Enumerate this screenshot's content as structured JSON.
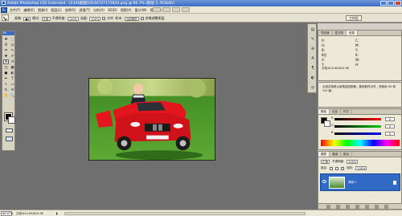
{
  "window": {
    "title": "Adobe Photoshop CS5 Extended - [2345截图20230727172834.png @ 66.7% (图层 1, RGB/8)]",
    "app_logo": "Ps",
    "minimize_icon": "minimize-icon",
    "maximize_icon": "maximize-icon",
    "close_icon": "close-icon"
  },
  "menu": {
    "items": [
      "文件(F)",
      "编辑(E)",
      "图像(I)",
      "图层(L)",
      "选择(S)",
      "滤镜(T)",
      "分析(A)",
      "3D(D)",
      "视图(V)",
      "窗口(W)",
      "帮助(H)"
    ]
  },
  "options": {
    "brush_label": "画笔:",
    "mode_label": "模式:",
    "mode_value": "正常",
    "opacity_label": "不透明度:",
    "opacity_value": "100%",
    "flow_label": "流量:",
    "flow_value": "100%",
    "align_label": "对齐",
    "sample_label": "样本:",
    "sample_value": "当前图层",
    "ignore_label": "忽略调整图层",
    "workspace": "工作区"
  },
  "toolbox": {
    "header": "Ps",
    "tools": [
      "move-tool",
      "marquee-tool",
      "lasso-tool",
      "quick-select-tool",
      "crop-tool",
      "eyedropper-tool",
      "healing-tool",
      "brush-tool",
      "clone-stamp-tool",
      "history-brush-tool",
      "eraser-tool",
      "gradient-tool",
      "blur-tool",
      "dodge-tool",
      "pen-tool",
      "type-tool",
      "path-select-tool",
      "shape-tool",
      "3d-rotate-tool",
      "3d-orbit-tool",
      "hand-tool",
      "zoom-tool"
    ],
    "glyphs": [
      "✥",
      "⬚",
      "ʘ",
      "◎",
      "⌗",
      "✎",
      "✚",
      "✐",
      "⊕",
      "↺",
      "◫",
      "▦",
      "●",
      "◐",
      "✒",
      "T",
      "↖",
      "▭",
      "↻",
      "⟲",
      "✋",
      "🔍"
    ],
    "selected_index": 8,
    "foreground_color": "#000000",
    "background_color": "#ffffff"
  },
  "status": {
    "zoom": "66.67%",
    "doc_info": "文档:614.9K/614.9K"
  },
  "info_panel": {
    "tabs": [
      "导航器",
      "直方图",
      "信息"
    ],
    "active_tab": 2,
    "rows": [
      {
        "a": "R:",
        "b": "C:"
      },
      {
        "a": "G:",
        "b": "M:"
      },
      {
        "a": "B:",
        "b": "Y:"
      },
      {
        "a": "8位",
        "b": "K:"
      },
      {
        "a": "X:",
        "b": "W:"
      },
      {
        "a": "Y:",
        "b": "H:"
      }
    ],
    "footer": "文档:614.9K/614.9K"
  },
  "hint": {
    "text": "点按并拖移以画笔复制图像。要用取样点时，请使用 Alt 和 Ctrl 键。"
  },
  "color_panel": {
    "tabs": [
      "颜色",
      "色板",
      "样式"
    ],
    "active_tab": 0,
    "r_label": "R",
    "g_label": "G",
    "b_label": "B",
    "r_value": "0",
    "g_value": "0",
    "b_value": "0",
    "foreground": "#000000",
    "background": "#ffffff"
  },
  "layers_panel": {
    "tabs": [
      "图层",
      "通道",
      "路径"
    ],
    "active_tab": 0,
    "blend_mode": "正常",
    "opacity_label": "不透明度:",
    "opacity_value": "100%",
    "lock_label": "锁定:",
    "fill_label": "填充:",
    "fill_value": "100%",
    "layer_name": "图层 1"
  }
}
